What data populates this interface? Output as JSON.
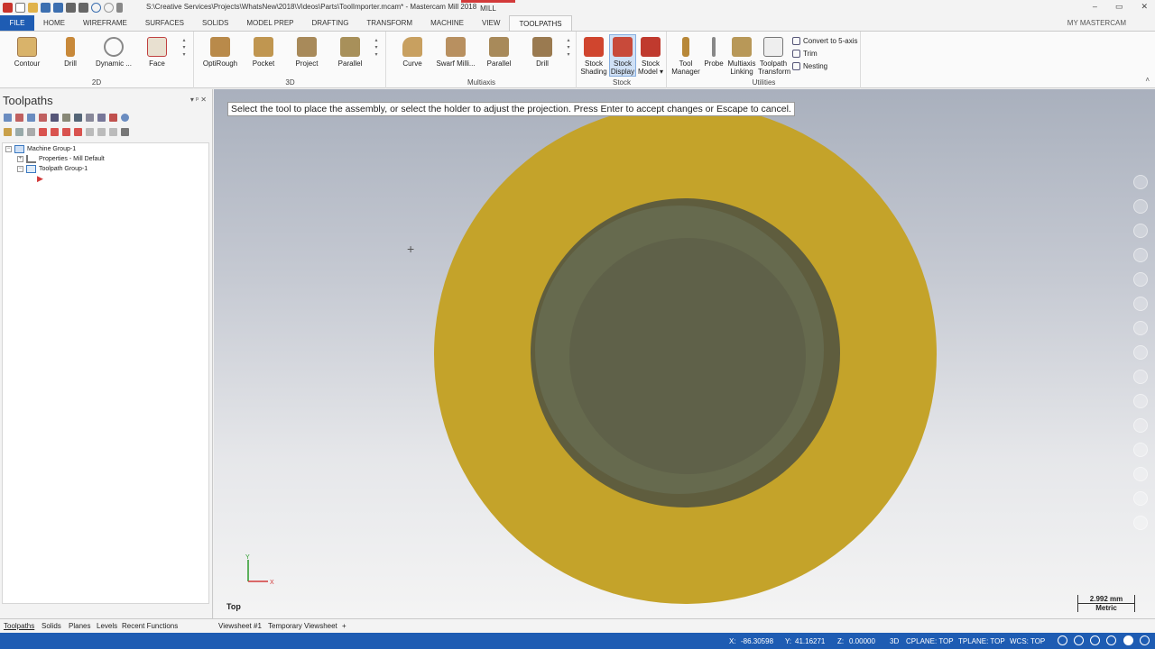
{
  "window": {
    "title": "S:\\Creative Services\\Projects\\WhatsNew\\2018\\Videos\\Parts\\ToolImporter.mcam* - Mastercam Mill 2018",
    "context_tab": "MILL",
    "minimize": "–",
    "restore": "▭",
    "close": "✕"
  },
  "ribbon_tabs": [
    "FILE",
    "HOME",
    "WIREFRAME",
    "SURFACES",
    "SOLIDS",
    "MODEL PREP",
    "DRAFTING",
    "TRANSFORM",
    "MACHINE",
    "VIEW",
    "TOOLPATHS"
  ],
  "active_tab": "TOOLPATHS",
  "my_mastercam": "MY MASTERCAM",
  "ribbon": {
    "groups": {
      "g2d": "2D",
      "g3d": "3D",
      "multiaxis": "Multiaxis",
      "stock": "Stock",
      "utilities": "Utilities"
    },
    "buttons_2d": [
      "Contour",
      "Drill",
      "Dynamic ...",
      "Face"
    ],
    "buttons_3d": [
      "OptiRough",
      "Pocket",
      "Project",
      "Parallel"
    ],
    "buttons_multiaxis": [
      "Curve",
      "Swarf Milli...",
      "Parallel",
      "Drill"
    ],
    "stock_shading": [
      "Stock",
      "Shading"
    ],
    "stock_display": [
      "Stock",
      "Display"
    ],
    "stock_model": [
      "Stock",
      "Model ▾"
    ],
    "tool_manager": [
      "Tool",
      "Manager"
    ],
    "probe": "Probe",
    "multiaxis_linking": [
      "Multiaxis",
      "Linking"
    ],
    "toolpath_transform": [
      "Toolpath",
      "Transform"
    ],
    "convert": "Convert to 5-axis",
    "trim": "Trim",
    "nesting": "Nesting"
  },
  "panel": {
    "title": "Toolpaths",
    "pin": "▾  ᵖ  ✕",
    "tree": {
      "machine_group": "Machine Group-1",
      "properties": "Properties - Mill Default",
      "toolpath_group": "Toolpath Group-1"
    }
  },
  "viewport": {
    "prompt": "Select the tool to place the assembly, or select the holder to adjust the projection. Press Enter to accept changes or Escape to cancel.",
    "view_name": "Top",
    "axis_y": "Y",
    "axis_x": "X",
    "scale_value": "2.992 mm",
    "scale_unit": "Metric",
    "colors": {
      "stock_outer": "#c4a32a",
      "stock_inner": "#5f6149"
    }
  },
  "bottom_tabs": {
    "toolpaths": "Toolpaths",
    "solids": "Solids",
    "planes": "Planes",
    "levels": "Levels",
    "recent": "Recent Functions",
    "viewsheet1": "Viewsheet #1",
    "temp_viewsheet": "Temporary Viewsheet",
    "add": "+"
  },
  "status": {
    "x_label": "X:",
    "x": "-86.30598",
    "y_label": "Y:",
    "y": "41.16271",
    "z_label": "Z:",
    "z": "0.00000",
    "mode": "3D",
    "cplane": "CPLANE: TOP",
    "tplane": "TPLANE: TOP",
    "wcs": "WCS: TOP"
  }
}
